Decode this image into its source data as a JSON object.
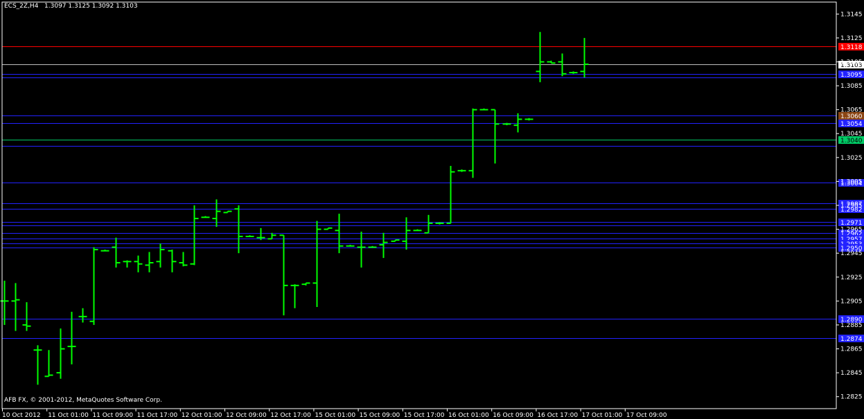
{
  "header": {
    "symbol": "ECS_2Z,H4",
    "ohlc": "1.3097 1.3125 1.3092 1.3103"
  },
  "copyright": "AFB FX, © 2001-2012, MetaQuotes Software Corp.",
  "colors": {
    "background": "#000000",
    "frame": "#ffffff",
    "bars": "#00ff00",
    "level_line": "#2222ff",
    "red_line": "#ff0000",
    "current_line": "#c0c0c0",
    "brown_label": "#8b4513",
    "green_line": "#00cc66"
  },
  "chart_data": {
    "type": "ohlc",
    "title": "ECS_2Z,H4",
    "ylim": [
      1.2815,
      1.3155
    ],
    "y_ticks": [
      "1.3145",
      "1.3125",
      "1.3105",
      "1.3085",
      "1.3065",
      "1.3045",
      "1.3025",
      "1.3005",
      "1.2985",
      "1.2965",
      "1.2945",
      "1.2925",
      "1.2905",
      "1.2885",
      "1.2865",
      "1.2845",
      "1.2825"
    ],
    "x_ticks": [
      "10 Oct 2012",
      "11 Oct 01:00",
      "11 Oct 09:00",
      "11 Oct 17:00",
      "12 Oct 01:00",
      "12 Oct 09:00",
      "12 Oct 17:00",
      "15 Oct 01:00",
      "15 Oct 09:00",
      "15 Oct 17:00",
      "16 Oct 01:00",
      "16 Oct 09:00",
      "16 Oct 17:00",
      "17 Oct 01:00",
      "17 Oct 09:00"
    ],
    "bars": [
      {
        "o": 1.2905,
        "h": 1.2922,
        "l": 1.2885,
        "c": 1.2905
      },
      {
        "o": 1.2905,
        "h": 1.292,
        "l": 1.288,
        "c": 1.2906
      },
      {
        "o": 1.2885,
        "h": 1.2904,
        "l": 1.288,
        "c": 1.2884
      },
      {
        "o": 1.2864,
        "h": 1.2868,
        "l": 1.2835,
        "c": 1.2864
      },
      {
        "o": 1.2842,
        "h": 1.2864,
        "l": 1.2842,
        "c": 1.2843
      },
      {
        "o": 1.2845,
        "h": 1.2882,
        "l": 1.284,
        "c": 1.2865
      },
      {
        "o": 1.2867,
        "h": 1.2896,
        "l": 1.2852,
        "c": 1.2867
      },
      {
        "o": 1.2892,
        "h": 1.2899,
        "l": 1.2887,
        "c": 1.2892
      },
      {
        "o": 1.2888,
        "h": 1.295,
        "l": 1.2885,
        "c": 1.2948
      },
      {
        "o": 1.2947,
        "h": 1.2948,
        "l": 1.2947,
        "c": 1.2947
      },
      {
        "o": 1.295,
        "h": 1.2958,
        "l": 1.2933,
        "c": 1.2937
      },
      {
        "o": 1.2938,
        "h": 1.2939,
        "l": 1.2933,
        "c": 1.2938
      },
      {
        "o": 1.2938,
        "h": 1.2943,
        "l": 1.2929,
        "c": 1.2936
      },
      {
        "o": 1.2935,
        "h": 1.2946,
        "l": 1.2929,
        "c": 1.2937
      },
      {
        "o": 1.2938,
        "h": 1.2953,
        "l": 1.2933,
        "c": 1.2948
      },
      {
        "o": 1.2947,
        "h": 1.2948,
        "l": 1.2929,
        "c": 1.2938
      },
      {
        "o": 1.2937,
        "h": 1.2946,
        "l": 1.2934,
        "c": 1.2935
      },
      {
        "o": 1.2936,
        "h": 1.2985,
        "l": 1.2935,
        "c": 1.2974
      },
      {
        "o": 1.2975,
        "h": 1.2976,
        "l": 1.2975,
        "c": 1.2975
      },
      {
        "o": 1.2974,
        "h": 1.299,
        "l": 1.2967,
        "c": 1.298
      },
      {
        "o": 1.2979,
        "h": 1.298,
        "l": 1.2979,
        "c": 1.298
      },
      {
        "o": 1.2982,
        "h": 1.2985,
        "l": 1.2945,
        "c": 1.2959
      },
      {
        "o": 1.2959,
        "h": 1.296,
        "l": 1.2959,
        "c": 1.2959
      },
      {
        "o": 1.2958,
        "h": 1.2966,
        "l": 1.2956,
        "c": 1.2958
      },
      {
        "o": 1.2957,
        "h": 1.2962,
        "l": 1.2957,
        "c": 1.296
      },
      {
        "o": 1.296,
        "h": 1.296,
        "l": 1.2893,
        "c": 1.2918
      },
      {
        "o": 1.2918,
        "h": 1.2919,
        "l": 1.2899,
        "c": 1.2918
      },
      {
        "o": 1.2919,
        "h": 1.292,
        "l": 1.2918,
        "c": 1.292
      },
      {
        "o": 1.292,
        "h": 1.2972,
        "l": 1.29,
        "c": 1.2965
      },
      {
        "o": 1.2965,
        "h": 1.2966,
        "l": 1.2965,
        "c": 1.2966
      },
      {
        "o": 1.2964,
        "h": 1.2978,
        "l": 1.2945,
        "c": 1.2951
      },
      {
        "o": 1.2951,
        "h": 1.2952,
        "l": 1.2951,
        "c": 1.2951
      },
      {
        "o": 1.295,
        "h": 1.2963,
        "l": 1.2933,
        "c": 1.295
      },
      {
        "o": 1.295,
        "h": 1.2951,
        "l": 1.295,
        "c": 1.295
      },
      {
        "o": 1.2952,
        "h": 1.2962,
        "l": 1.2941,
        "c": 1.2954
      },
      {
        "o": 1.2955,
        "h": 1.2956,
        "l": 1.2955,
        "c": 1.2956
      },
      {
        "o": 1.2955,
        "h": 1.2975,
        "l": 1.2948,
        "c": 1.2964
      },
      {
        "o": 1.2964,
        "h": 1.2965,
        "l": 1.2964,
        "c": 1.2964
      },
      {
        "o": 1.2962,
        "h": 1.2977,
        "l": 1.2962,
        "c": 1.297
      },
      {
        "o": 1.297,
        "h": 1.2971,
        "l": 1.2969,
        "c": 1.297
      },
      {
        "o": 1.297,
        "h": 1.3018,
        "l": 1.297,
        "c": 1.3013
      },
      {
        "o": 1.3014,
        "h": 1.3015,
        "l": 1.3013,
        "c": 1.3014
      },
      {
        "o": 1.3014,
        "h": 1.3066,
        "l": 1.3008,
        "c": 1.3065
      },
      {
        "o": 1.3065,
        "h": 1.3066,
        "l": 1.3065,
        "c": 1.3065
      },
      {
        "o": 1.3065,
        "h": 1.3065,
        "l": 1.302,
        "c": 1.3053
      },
      {
        "o": 1.3053,
        "h": 1.3054,
        "l": 1.3052,
        "c": 1.3053
      },
      {
        "o": 1.3052,
        "h": 1.3062,
        "l": 1.3046,
        "c": 1.3057
      },
      {
        "o": 1.3057,
        "h": 1.3058,
        "l": 1.3056,
        "c": 1.3057
      },
      {
        "o": 1.3097,
        "h": 1.313,
        "l": 1.3088,
        "c": 1.3105
      },
      {
        "o": 1.3105,
        "h": 1.3106,
        "l": 1.3104,
        "c": 1.3104
      },
      {
        "o": 1.3105,
        "h": 1.3112,
        "l": 1.3093,
        "c": 1.3095
      },
      {
        "o": 1.3096,
        "h": 1.3097,
        "l": 1.3095,
        "c": 1.3096
      },
      {
        "o": 1.3097,
        "h": 1.3125,
        "l": 1.3092,
        "c": 1.3103
      }
    ],
    "levels": [
      {
        "price": 1.3118,
        "label": "1.3118",
        "color": "#ff0000"
      },
      {
        "price": 1.3103,
        "label": "1.3103",
        "color": "#c0c0c0",
        "label_bg": "#ffffff",
        "label_fg": "#000000"
      },
      {
        "price": 1.3095,
        "label": "1.3095",
        "color": "#2222ff"
      },
      {
        "price": 1.3092,
        "label": "",
        "color": "#2222ff"
      },
      {
        "price": 1.306,
        "label": "1.3060",
        "color": "#2222ff",
        "label_bg": "#8b4513"
      },
      {
        "price": 1.3054,
        "label": "1.3054",
        "color": "#2222ff"
      },
      {
        "price": 1.304,
        "label": "1.3040",
        "color": "#00cc66",
        "label_bg": "#00cc66",
        "label_fg": "#000000"
      },
      {
        "price": 1.3035,
        "label": "",
        "color": "#2222ff"
      },
      {
        "price": 1.3004,
        "label": "1.3004",
        "color": "#2222ff"
      },
      {
        "price": 1.2987,
        "label": "1.2987",
        "color": "#2222ff"
      },
      {
        "price": 1.2982,
        "label": "1.2982",
        "color": "#2222ff"
      },
      {
        "price": 1.2971,
        "label": "1.2971",
        "color": "#2222ff"
      },
      {
        "price": 1.2968,
        "label": "",
        "color": "#2222ff"
      },
      {
        "price": 1.2962,
        "label": "1.2962",
        "color": "#2222ff"
      },
      {
        "price": 1.2957,
        "label": "1.2957",
        "color": "#2222ff"
      },
      {
        "price": 1.2953,
        "label": "1.2953",
        "color": "#2222ff"
      },
      {
        "price": 1.295,
        "label": "1.2950",
        "color": "#2222ff"
      },
      {
        "price": 1.289,
        "label": "1.2890",
        "color": "#2222ff"
      },
      {
        "price": 1.2874,
        "label": "1.2874",
        "color": "#2222ff"
      }
    ]
  }
}
